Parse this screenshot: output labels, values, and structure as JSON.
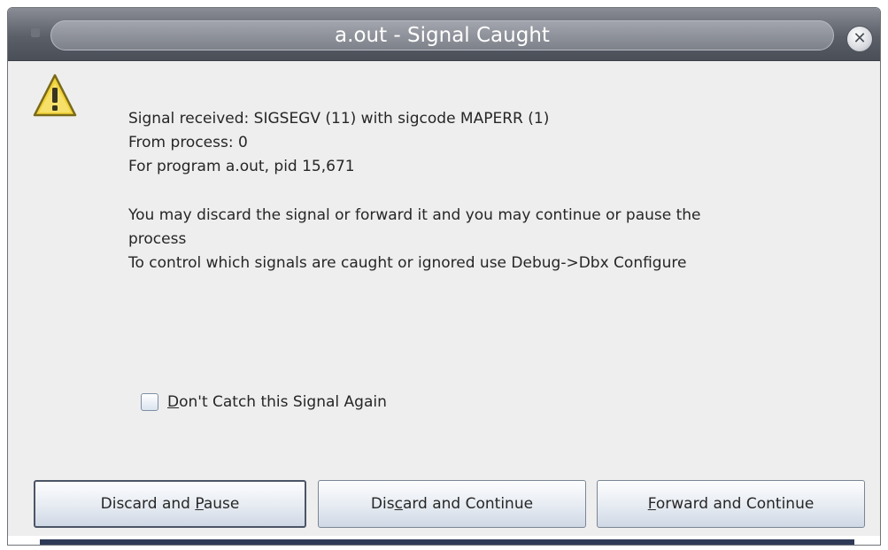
{
  "window": {
    "title": "a.out - Signal Caught"
  },
  "message": {
    "lines": [
      "Signal received: SIGSEGV (11) with sigcode MAPERR (1)",
      "From process: 0",
      "For program a.out, pid 15,671",
      "You may discard the signal or forward it and you may continue or pause the",
      "process",
      "To control which signals are caught or ignored use Debug->Dbx Configure"
    ]
  },
  "checkbox": {
    "label": "Don't Catch this Signal Again",
    "checked": false
  },
  "buttons": [
    {
      "pre": "Discard and ",
      "mnemonic": "P",
      "post": "ause"
    },
    {
      "pre": "Dis",
      "mnemonic": "c",
      "post": "ard and Continue"
    },
    {
      "pre": "",
      "mnemonic": "F",
      "post": "orward and Continue"
    }
  ],
  "icons": {
    "close": "close-icon",
    "warning": "warning-icon",
    "menu": "window-menu-icon"
  },
  "colors": {
    "titlebar": "#5b5f68",
    "dialog_bg": "#eeeeee",
    "warning_yellow": "#f2d33b"
  }
}
